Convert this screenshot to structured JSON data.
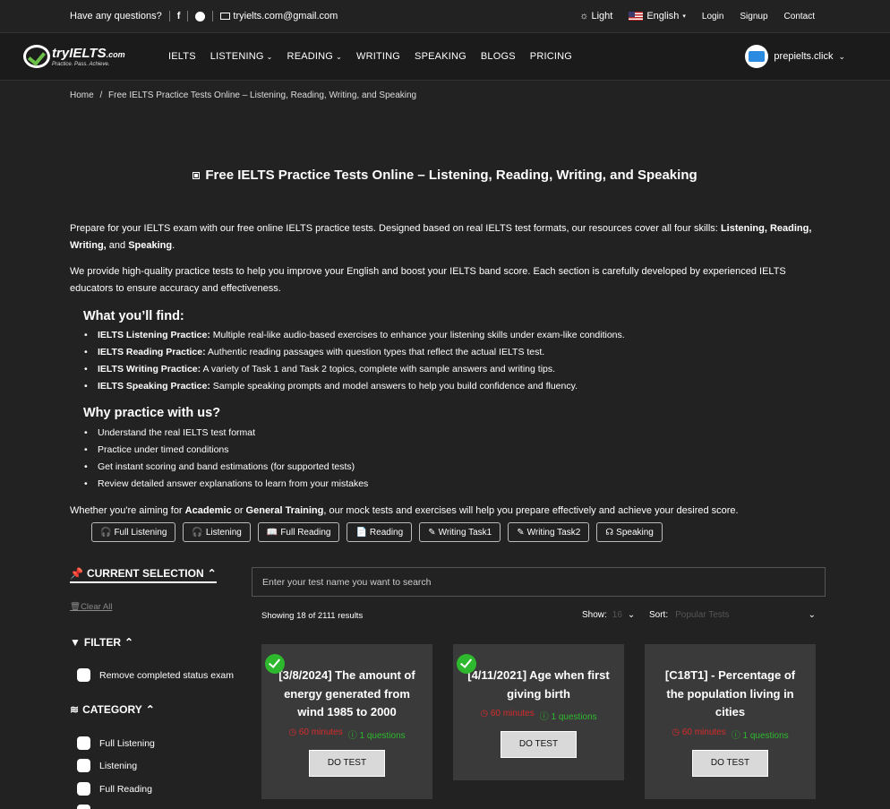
{
  "topbar": {
    "question": "Have any questions?",
    "email": "tryielts.com@gmail.com",
    "theme": "Light",
    "language": "English",
    "login": "Login",
    "signup": "Signup",
    "contact": "Contact"
  },
  "nav": {
    "logo_try": "try",
    "logo_ielts": "IELTS",
    "logo_com": ".com",
    "logo_tagline": "Practice. Pass. Achieve.",
    "items": [
      "IELTS",
      "LISTENING",
      "READING",
      "WRITING",
      "SPEAKING",
      "BLOGS",
      "PRICING"
    ],
    "user": "prepielts.click"
  },
  "breadcrumb": {
    "home": "Home",
    "sep": "/",
    "current": "Free IELTS Practice Tests Online – Listening, Reading, Writing, and Speaking"
  },
  "page_title": "Free IELTS Practice Tests Online – Listening, Reading, Writing, and Speaking",
  "intro": {
    "p1_a": "Prepare for your IELTS exam with our free online IELTS practice tests. Designed based on real IELTS test formats, our resources cover all four skills: ",
    "p1_b": "Listening, Reading, Writing,",
    "p1_c": " and ",
    "p1_d": "Speaking",
    "p1_e": ".",
    "p2": "We provide high-quality practice tests to help you improve your English and boost your IELTS band score. Each section is carefully developed by experienced IELTS educators to ensure accuracy and effectiveness."
  },
  "find": {
    "heading": "What you’ll find:",
    "items": [
      {
        "b": "IELTS Listening Practice:",
        "t": " Multiple real-like audio-based exercises to enhance your listening skills under exam-like conditions."
      },
      {
        "b": "IELTS Reading Practice:",
        "t": " Authentic reading passages with question types that reflect the actual IELTS test."
      },
      {
        "b": "IELTS Writing Practice:",
        "t": " A variety of Task 1 and Task 2 topics, complete with sample answers and writing tips."
      },
      {
        "b": "IELTS Speaking Practice:",
        "t": " Sample speaking prompts and model answers to help you build confidence and fluency."
      }
    ]
  },
  "why": {
    "heading": "Why practice with us?",
    "items": [
      "Understand the real IELTS test format",
      "Practice under timed conditions",
      "Get instant scoring and band estimations (for supported tests)",
      "Review detailed answer explanations to learn from your mistakes"
    ]
  },
  "closing": {
    "a": "Whether you're aiming for ",
    "b": "Academic",
    "c": " or ",
    "d": "General Training",
    "e": ", our mock tests and exercises will help you prepare effectively and achieve your desired score."
  },
  "chips": [
    "Full Listening",
    "Listening",
    "Full Reading",
    "Reading",
    "Writing Task1",
    "Writing Task2",
    "Speaking"
  ],
  "sidebar": {
    "current_selection": "CURRENT SELECTION",
    "clear_all": "Clear All",
    "filter": "FILTER",
    "remove_completed": "Remove completed status exam",
    "category": "CATEGORY",
    "categories": [
      "Full Listening",
      "Listening",
      "Full Reading"
    ]
  },
  "search": {
    "placeholder": "Enter your test name you want to search"
  },
  "results": {
    "showing": "Showing 18 of 2111 results",
    "show_label": "Show:",
    "show_value": "16",
    "sort_label": "Sort:",
    "sort_value": "Popular Tests"
  },
  "cards": [
    {
      "title": "[3/8/2024] The amount of energy generated from wind 1985 to 2000",
      "minutes": "60 minutes",
      "questions": "1 questions",
      "button": "DO TEST",
      "completed": true
    },
    {
      "title": "[4/11/2021] Age when first giving birth",
      "minutes": "60 minutes",
      "questions": "1 questions",
      "button": "DO TEST",
      "completed": true
    },
    {
      "title": "[C18T1] - Percentage of the population living in cities",
      "minutes": "60 minutes",
      "questions": "1 questions",
      "button": "DO TEST",
      "completed": false
    }
  ],
  "colors": {
    "background": "#222222",
    "navbar": "#1b1b1b",
    "card": "#3a3a3a",
    "minutes": "#d62b2b",
    "questions": "#2eb82e",
    "check": "#2eb82e"
  }
}
